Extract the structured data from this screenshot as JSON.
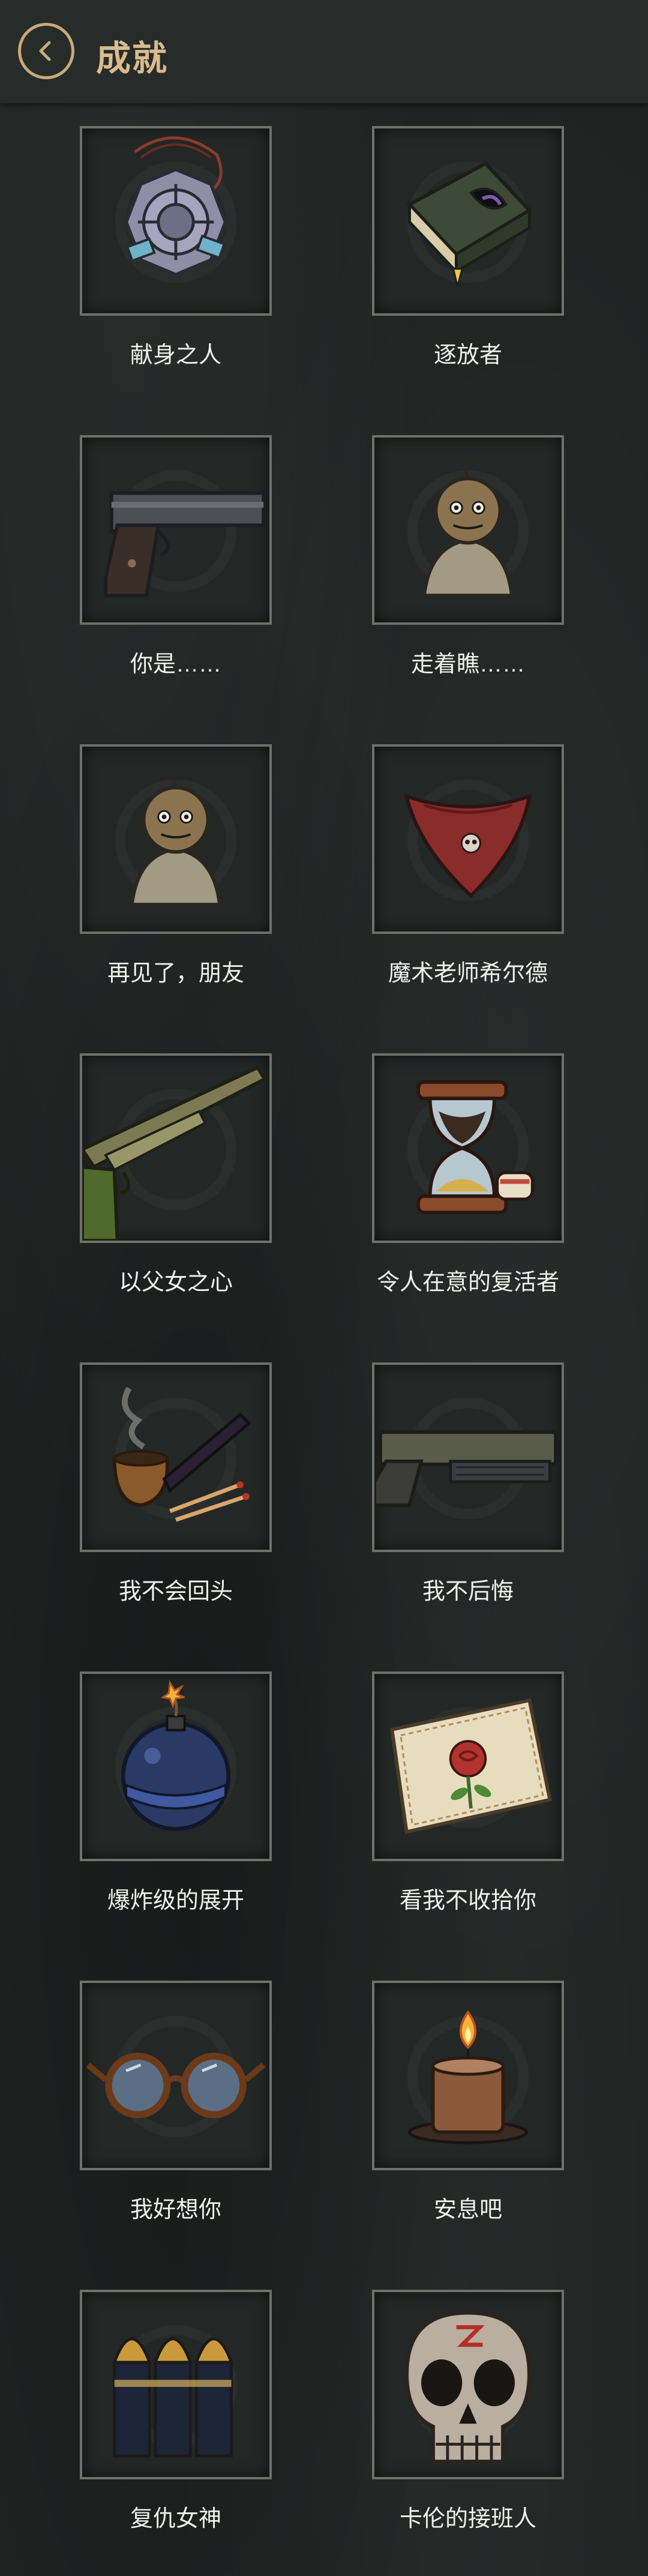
{
  "header": {
    "title": "成就",
    "back_icon": "chevron-left-icon"
  },
  "colors": {
    "accent": "#c9a978",
    "frame": "#6e706b",
    "background": "#1f2322"
  },
  "achievements": [
    {
      "label": "献身之人",
      "icon": "amulet-icon"
    },
    {
      "label": "逐放者",
      "icon": "book-icon"
    },
    {
      "label": "你是……",
      "icon": "pistol-icon"
    },
    {
      "label": "走着瞧……",
      "icon": "voodoo-doll-icon"
    },
    {
      "label": "再见了，朋友",
      "icon": "voodoo-doll-icon"
    },
    {
      "label": "魔术老师希尔德",
      "icon": "bandana-icon"
    },
    {
      "label": "以父女之心",
      "icon": "shotgun-icon"
    },
    {
      "label": "令人在意的复活者",
      "icon": "hourglass-icon"
    },
    {
      "label": "我不会回头",
      "icon": "pipe-icon"
    },
    {
      "label": "我不后悔",
      "icon": "gun-icon"
    },
    {
      "label": "爆炸级的展开",
      "icon": "bomb-icon"
    },
    {
      "label": "看我不收拾你",
      "icon": "rose-cloth-icon"
    },
    {
      "label": "我好想你",
      "icon": "glasses-icon"
    },
    {
      "label": "安息吧",
      "icon": "candle-icon"
    },
    {
      "label": "复仇女神",
      "icon": "bullets-icon"
    },
    {
      "label": "卡伦的接班人",
      "icon": "skull-icon"
    }
  ]
}
